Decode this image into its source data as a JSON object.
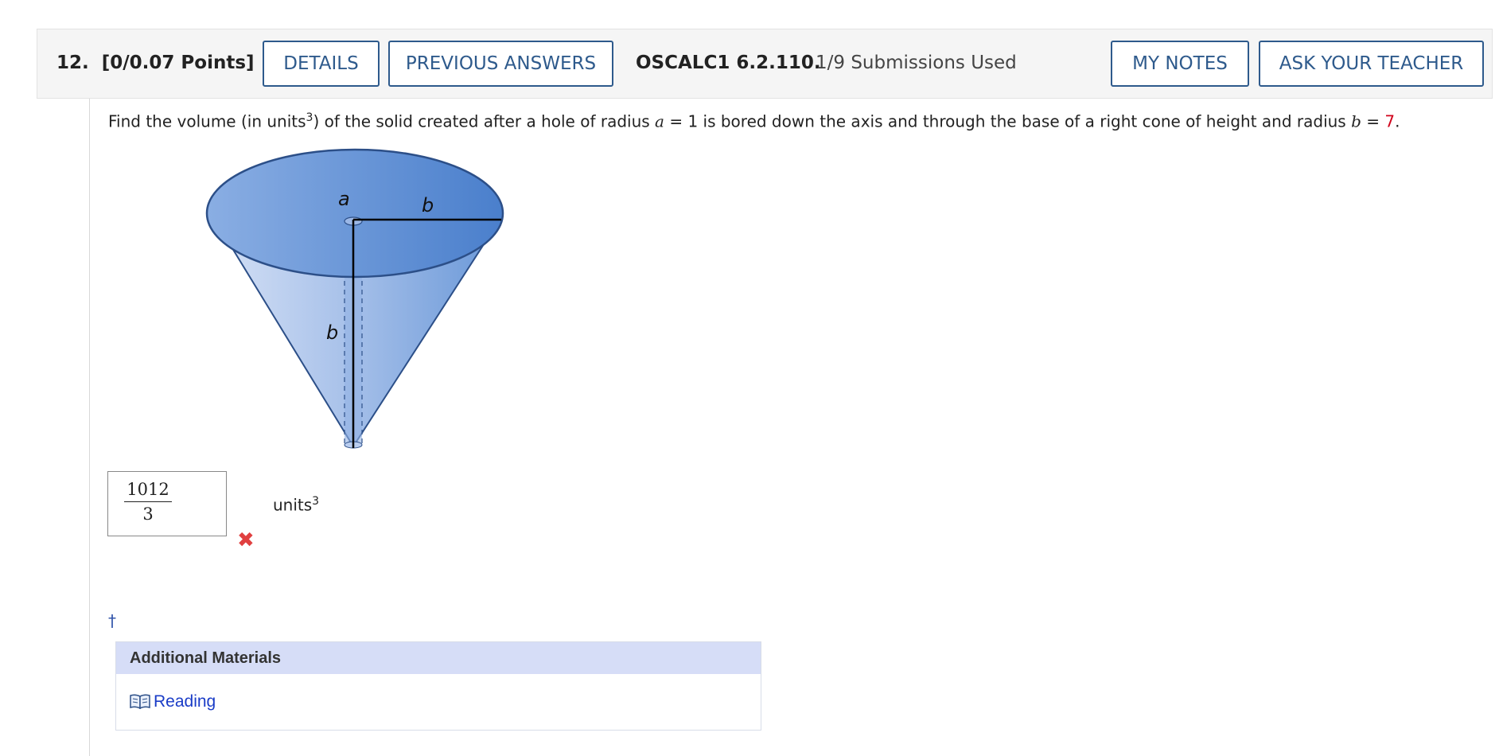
{
  "header": {
    "question_number": "12.",
    "points": "[0/0.07 Points]",
    "details_label": "DETAILS",
    "previous_answers_label": "PREVIOUS ANSWERS",
    "problem_code": "OSCALC1 6.2.110.",
    "submissions": "1/9 Submissions Used",
    "my_notes_label": "MY NOTES",
    "ask_teacher_label": "ASK YOUR TEACHER"
  },
  "question": {
    "text_1": "Find the volume (in units",
    "exp": "3",
    "text_2": ") of the solid created after a hole of radius ",
    "var_a": "a",
    "text_3": " = 1 is bored down the axis and through the base of a right cone of height and radius ",
    "var_b": "b",
    "text_4": " = ",
    "b_value": "7",
    "text_5": "."
  },
  "figure": {
    "label_a": "a",
    "label_b_top": "b",
    "label_b_side": "b"
  },
  "answer": {
    "numerator": "1012",
    "denominator": "3",
    "units": "units",
    "units_exp": "3",
    "status": "incorrect",
    "status_icon": "✖"
  },
  "footnote_marker": "†",
  "additional_materials": {
    "title": "Additional Materials",
    "link_label": "Reading",
    "link_icon": "book-icon"
  },
  "colors": {
    "accent": "#2e5a8c",
    "error": "#e04040",
    "value_red": "#d0021b",
    "materials_header": "#d6ddf7",
    "link": "#1a3cc7"
  }
}
